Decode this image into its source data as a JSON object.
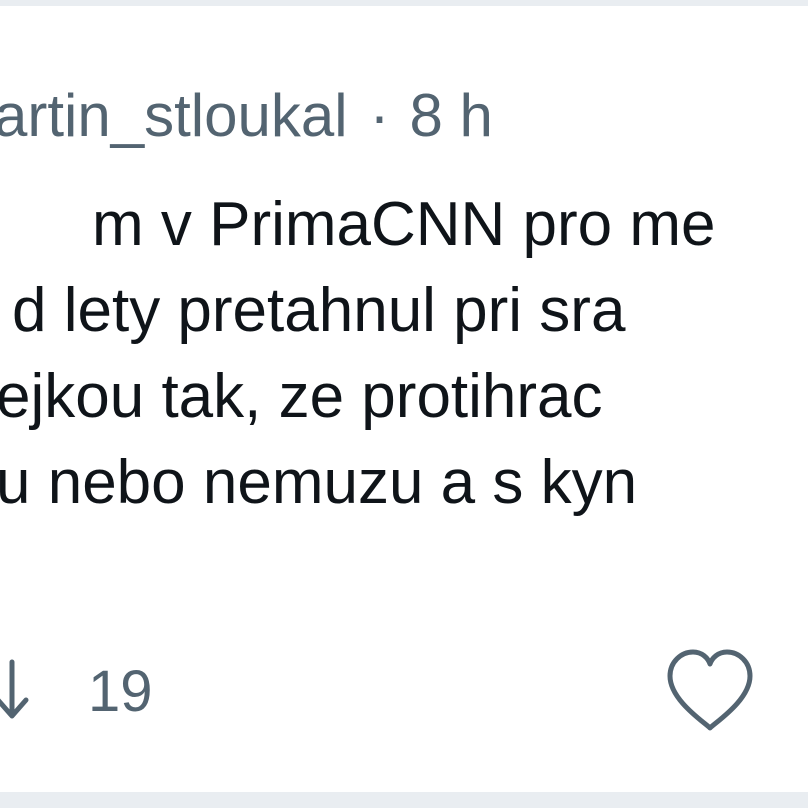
{
  "tweet": {
    "handle": "artin_stloukal",
    "separator": "·",
    "time": "8 h",
    "lines": [
      "m v PrimaCNN pro me",
      "d lety pretahnul pri sra",
      "ejkou tak, ze protihrac",
      "u nebo nemuzu a s kyn"
    ]
  },
  "actions": {
    "retweet": {
      "icon": "retweet-icon",
      "count": "19"
    },
    "like": {
      "icon": "heart-icon"
    }
  },
  "colors": {
    "text": "#0f1419",
    "muted": "#536471",
    "background": "#ffffff",
    "border": "#e9edf1"
  }
}
